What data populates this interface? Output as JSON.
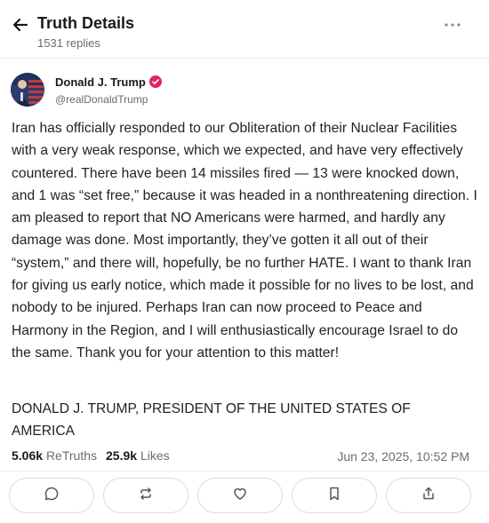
{
  "header": {
    "title": "Truth Details",
    "subtitle": "1531 replies",
    "back_icon": "arrow-left-icon",
    "more_icon": "more-horizontal-icon"
  },
  "author": {
    "name": "Donald J. Trump",
    "handle": "@realDonaldTrump",
    "verified_color": "#e0245e",
    "avatar": "avatar-image"
  },
  "post": {
    "body": "Iran has officially responded to our Obliteration of their Nuclear Facilities with a very weak response, which we expected, and have very effectively countered. There have been 14 missiles fired — 13 were knocked down, and 1 was “set free,” because it was headed in a nonthreatening direction. I am pleased to report that NO Americans were harmed, and hardly any damage was done. Most importantly, they’ve gotten it all out of their “system,” and there will, hopefully, be no further HATE. I want to thank Iran for giving us early notice, which made it possible for no lives to be lost, and nobody to be injured. Perhaps Iran can now proceed to Peace and Harmony in the Region, and I will enthusiastically encourage Israel to do the same. Thank you for your attention to this matter!",
    "signature": "DONALD J. TRUMP, PRESIDENT OF THE UNITED STATES OF AMERICA"
  },
  "stats": {
    "retruths_count": "5.06k",
    "retruths_label": "ReTruths",
    "likes_count": "25.9k",
    "likes_label": "Likes",
    "timestamp": "Jun 23, 2025, 10:52 PM"
  },
  "actions": [
    {
      "name": "reply",
      "icon": "comment-icon"
    },
    {
      "name": "retruth",
      "icon": "repost-icon"
    },
    {
      "name": "like",
      "icon": "heart-icon"
    },
    {
      "name": "bookmark",
      "icon": "bookmark-icon"
    },
    {
      "name": "share",
      "icon": "share-icon"
    }
  ]
}
